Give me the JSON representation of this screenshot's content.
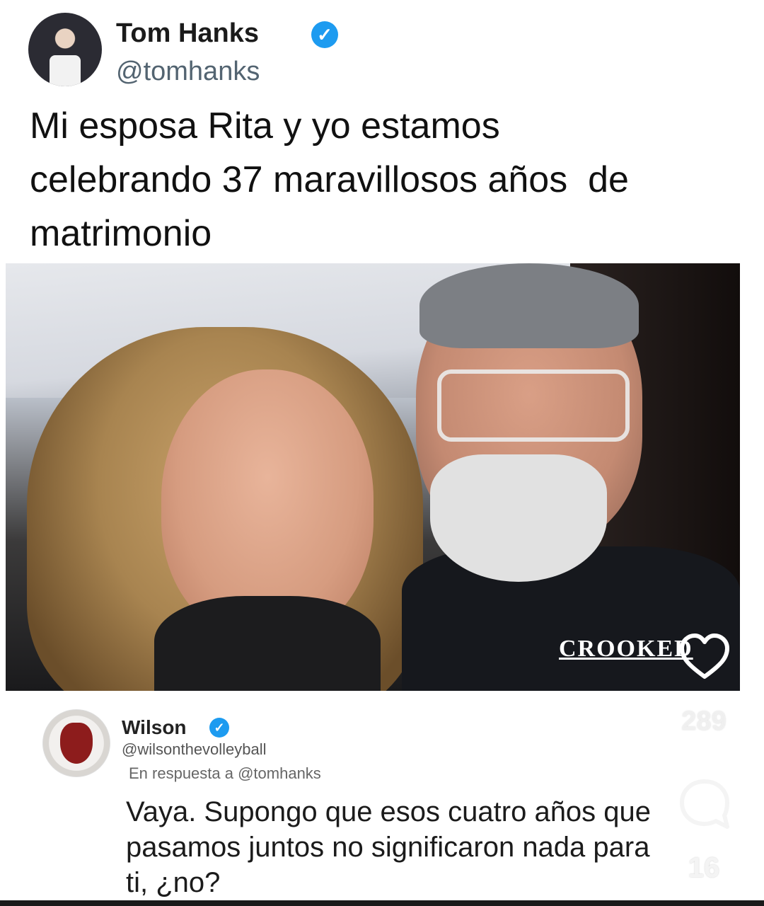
{
  "tweet": {
    "author_name": "Tom Hanks",
    "author_handle": "@tomhanks",
    "text": "Mi esposa Rita y yo estamos\ncelebrando 37 maravillosos años  de\nmatrimonio",
    "verified_icon": "verified-badge-icon"
  },
  "photo": {
    "magazine_logo": "CROOKED"
  },
  "actions": {
    "like_count": "289",
    "comment_count": "16"
  },
  "reply": {
    "author_name": "Wilson",
    "author_handle": "@wilsonthevolleyball",
    "reply_to": "En respuesta a @tomhanks",
    "text": "Vaya. Supongo que esos cuatro años que pasamos juntos no significaron nada para ti, ¿no?"
  },
  "colors": {
    "verified": "#1d9bf0",
    "handle": "#536471"
  }
}
